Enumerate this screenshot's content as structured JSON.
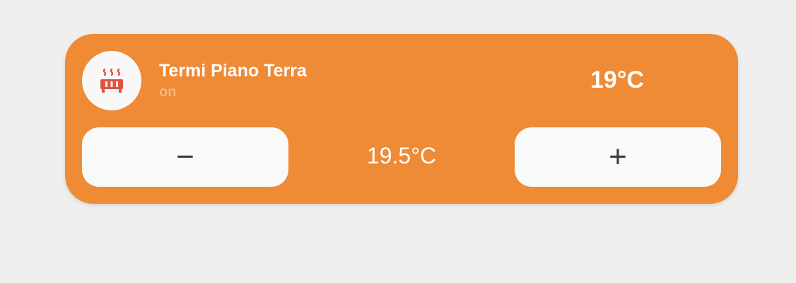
{
  "card": {
    "title": "Termi Piano Terra",
    "state": "on",
    "current_temperature": "19°C",
    "target_temperature": "19.5°C",
    "icon": "radiator-icon",
    "decrease_label": "−",
    "increase_label": "+"
  },
  "colors": {
    "background": "#efefef",
    "card": "#ef8a35",
    "button": "#f9f9f9",
    "icon": "#e2533f",
    "state_text": "#f6b782"
  }
}
